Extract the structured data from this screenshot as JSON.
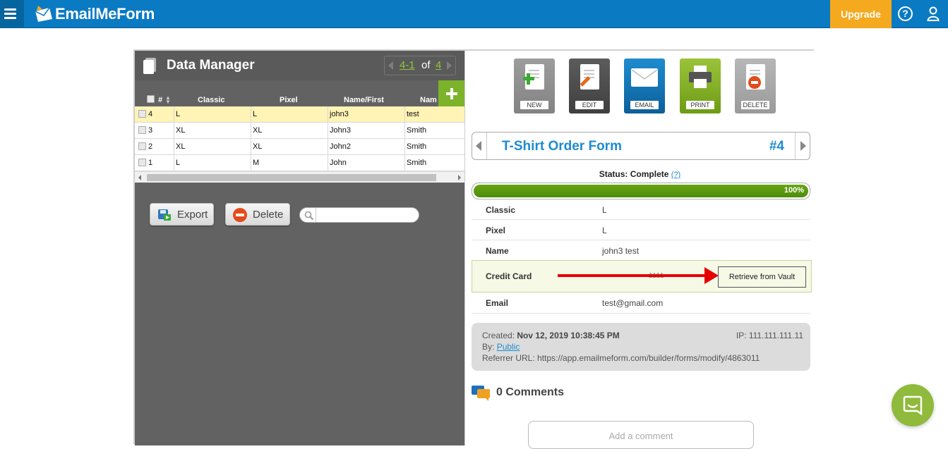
{
  "app": {
    "logo_text": "EmailMeForm",
    "upgrade_label": "Upgrade",
    "help_glyph": "?"
  },
  "data_manager": {
    "title": "Data Manager",
    "pager": {
      "current": "4-1",
      "of_label": "of",
      "total": "4"
    },
    "columns": [
      "#",
      "Classic",
      "Pixel",
      "Name/First",
      "Nam"
    ],
    "rows": [
      {
        "num": "4",
        "classic": "L",
        "pixel": "L",
        "first": "john3",
        "last": "test",
        "selected": true
      },
      {
        "num": "3",
        "classic": "XL",
        "pixel": "XL",
        "first": "John3",
        "last": "Smith",
        "selected": false
      },
      {
        "num": "2",
        "classic": "XL",
        "pixel": "XL",
        "first": "John2",
        "last": "Smith",
        "selected": false
      },
      {
        "num": "1",
        "classic": "L",
        "pixel": "M",
        "first": "John",
        "last": "Smith",
        "selected": false
      }
    ],
    "export_label": "Export",
    "delete_label": "Delete",
    "search": {
      "value": "",
      "placeholder": ""
    }
  },
  "toolbar": {
    "new_label": "NEW",
    "edit_label": "EDIT",
    "email_label": "EMAIL",
    "print_label": "PRINT",
    "delete_label": "DELETE"
  },
  "entry": {
    "form_title": "T-Shirt Order Form",
    "entry_number": "#4",
    "status_label": "Status: Complete",
    "status_help": "(?)",
    "progress_percent": 100,
    "progress_text": "100%",
    "fields": [
      {
        "label": "Classic",
        "value": "L"
      },
      {
        "label": "Pixel",
        "value": "L"
      },
      {
        "label": "Name",
        "value": "john3 test"
      },
      {
        "label": "Credit Card",
        "value": "1111"
      },
      {
        "label": "Email",
        "value": "test@gmail.com"
      }
    ],
    "vault_button": "Retrieve from Vault"
  },
  "meta": {
    "created_label": "Created:",
    "created_value": "Nov 12, 2019 10:38:45 PM",
    "ip_text": "IP: 111.111.111.11",
    "by_label": "By:",
    "by_value": "Public",
    "referrer_text": "Referrer URL: https://app.emailmeform.com/builder/forms/modify/4863011"
  },
  "comments": {
    "title": "0 Comments",
    "add_placeholder": "Add a comment"
  },
  "colors": {
    "brand_blue": "#0a7ac3",
    "upgrade_orange": "#f5a91e",
    "accent_green": "#7cb32a",
    "title_blue": "#1e8ccf",
    "arrow_red": "#e60000"
  }
}
